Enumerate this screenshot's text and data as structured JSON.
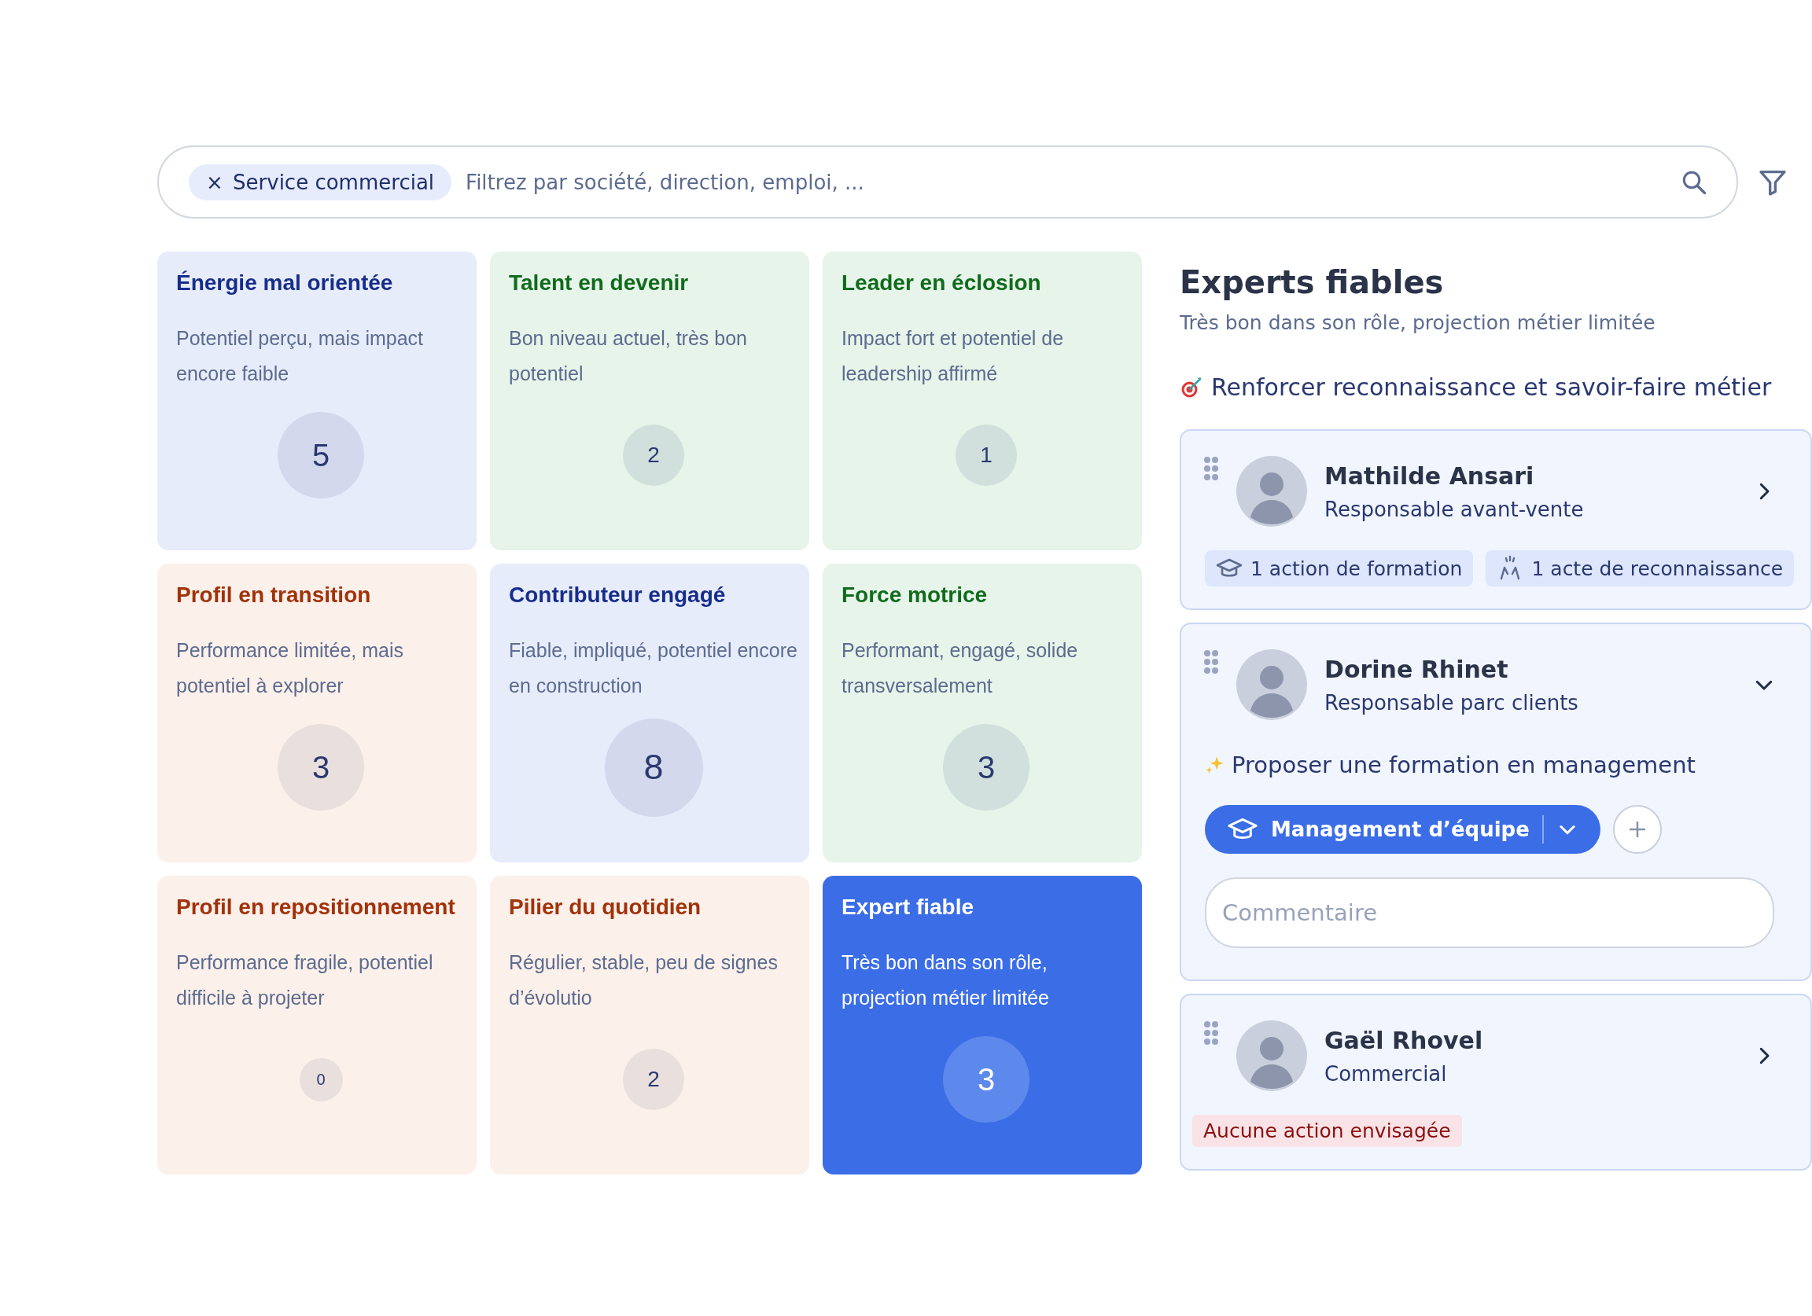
{
  "search": {
    "chip": "Service commercial",
    "chip_remove": "×",
    "placeholder": "Filtrez par société, direction, emploi, ..."
  },
  "grid": [
    {
      "title": "Énergie mal orientée",
      "description": "Potentiel perçu, mais impact encore faible",
      "count": "5",
      "kind": "watch",
      "selected": false
    },
    {
      "title": "Talent en devenir",
      "description": "Bon niveau actuel, très bon potentiel",
      "count": "2",
      "kind": "good",
      "selected": false
    },
    {
      "title": "Leader en éclosion",
      "description": "Impact fort et potentiel de leadership affirmé",
      "count": "1",
      "kind": "good",
      "selected": false
    },
    {
      "title": "Profil en transition",
      "description": "Performance limitée, mais potentiel à explorer",
      "count": "3",
      "kind": "risk",
      "selected": false
    },
    {
      "title": "Contributeur engagé",
      "description": "Fiable, impliqué, potentiel encore en construction",
      "count": "8",
      "kind": "watch",
      "selected": false
    },
    {
      "title": "Force motrice",
      "description": "Performant, engagé, solide transversalement",
      "count": "3",
      "kind": "good",
      "selected": false
    },
    {
      "title": "Profil en repositionnement",
      "description": "Performance fragile, potentiel difficile à projeter",
      "count": "0",
      "kind": "risk",
      "selected": false
    },
    {
      "title": "Pilier du quotidien",
      "description": "Régulier, stable, peu de signes d’évolutio",
      "count": "2",
      "kind": "risk",
      "selected": false
    },
    {
      "title": "Expert fiable",
      "description": "Très bon dans son rôle, projection métier limitée",
      "count": "3",
      "kind": "watch",
      "selected": true
    }
  ],
  "panel": {
    "title": "Experts fiables",
    "subtitle": "Très bon dans son rôle, projection métier limitée",
    "goal": "Renforcer reconnaissance et savoir-faire métier",
    "people": [
      {
        "name": "Mathilde Ansari",
        "role": "Responsable avant-vente",
        "expanded": false,
        "tags": [
          {
            "kind": "training",
            "label": "1 action de formation"
          },
          {
            "kind": "recognition",
            "label": "1 acte de reconnaissance"
          }
        ]
      },
      {
        "name": "Dorine Rhinet",
        "role": "Responsable parc clients",
        "expanded": true,
        "suggestion": "Proposer une formation en management",
        "training": "Management d’équipe",
        "comment_placeholder": "Commentaire"
      },
      {
        "name": "Gaël Rhovel",
        "role": "Commercial",
        "expanded": false,
        "note": "Aucune action envisagée"
      }
    ]
  }
}
